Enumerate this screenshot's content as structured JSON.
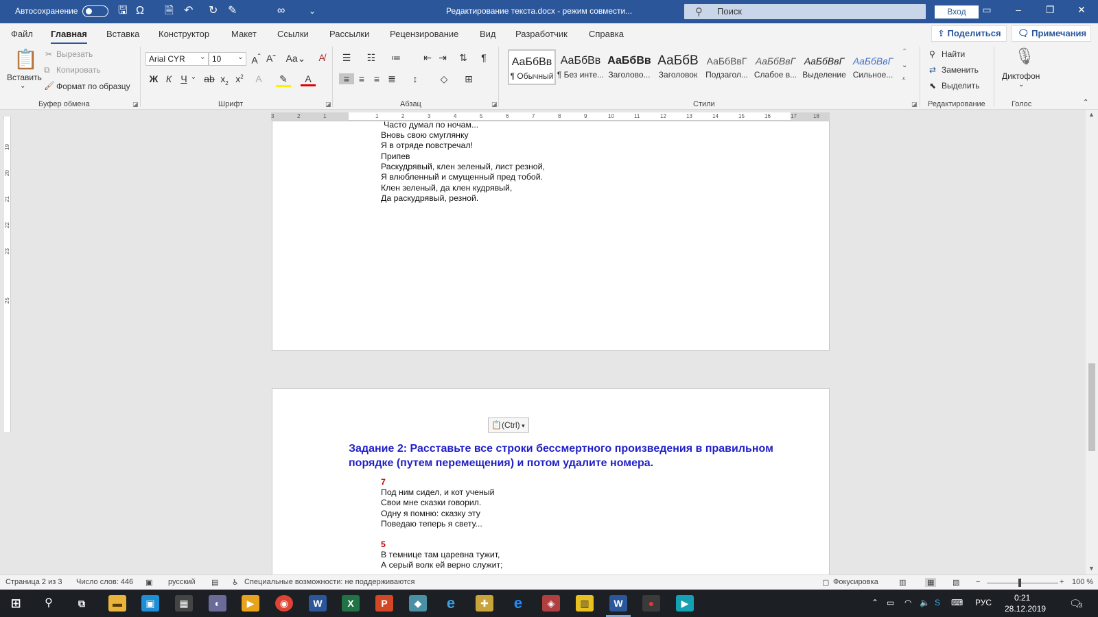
{
  "titlebar": {
    "autosave_label": "Автосохранение",
    "document_title": "Редактирование текста.docx  -  режим совмести...",
    "search_placeholder": "Поиск",
    "signin_label": "Вход"
  },
  "ribbon_tabs": [
    "Файл",
    "Главная",
    "Вставка",
    "Конструктор",
    "Макет",
    "Ссылки",
    "Рассылки",
    "Рецензирование",
    "Вид",
    "Разработчик",
    "Справка"
  ],
  "share_label": "Поделиться",
  "comments_label": "Примечания",
  "clipboard": {
    "paste": "Вставить",
    "cut": "Вырезать",
    "copy": "Копировать",
    "format_painter": "Формат по образцу",
    "group": "Буфер обмена"
  },
  "font": {
    "name": "Arial CYR",
    "size": "10",
    "group": "Шрифт"
  },
  "paragraph": {
    "group": "Абзац"
  },
  "styles": {
    "group": "Стили",
    "items": [
      {
        "sample": "АаБбВв",
        "name": "¶ Обычный"
      },
      {
        "sample": "АаБбВв",
        "name": "¶ Без инте..."
      },
      {
        "sample": "АаБбВв",
        "name": "Заголово..."
      },
      {
        "sample": "АаБбВ",
        "name": "Заголовок"
      },
      {
        "sample": "АаБбВвГ",
        "name": "Подзагол..."
      },
      {
        "sample": "АаБбВвГ",
        "name": "Слабое в..."
      },
      {
        "sample": "АаБбВвГ",
        "name": "Выделение"
      },
      {
        "sample": "АаБбВвГ",
        "name": "Сильное..."
      }
    ]
  },
  "editing": {
    "find": "Найти",
    "replace": "Заменить",
    "select": "Выделить",
    "group": "Редактирование"
  },
  "voice": {
    "dictate": "Диктофон",
    "group": "Голос"
  },
  "ruler_h": [
    "3",
    "2",
    "1",
    "1",
    "2",
    "3",
    "4",
    "5",
    "6",
    "7",
    "8",
    "9",
    "10",
    "11",
    "12",
    "13",
    "14",
    "15",
    "16",
    "17",
    "18"
  ],
  "ruler_v": [
    "19",
    "20",
    "21",
    "22",
    "23",
    "25"
  ],
  "page1_lines": [
    "Часто думал по ночам...",
    " Вновь свою смуглянку",
    " Я в отряде повстречал!",
    "Припев",
    "Раскудрявый, клен зеленый, лист резной,",
    "Я влюбленный и смущенный пред тобой.",
    "Клен зеленый, да клен кудрявый,",
    "Да раскудрявый, резной."
  ],
  "paste_tag": "(Ctrl)",
  "task_heading": "Задание 2: Расставьте все строки бессмертного произведения в правильном порядке (путем перемещения) и потом удалите номера.",
  "page2_blocks": [
    {
      "num": "7",
      "lines": [
        "Под ним сидел, и кот ученый",
        "Свои мне сказки говорил.",
        "Одну я помню: сказку эту",
        "Поведаю теперь я свету..."
      ]
    },
    {
      "num": "5",
      "lines": [
        "В темнице там царевна тужит,",
        "А серый волк ей верно служит;"
      ]
    }
  ],
  "statusbar": {
    "page": "Страница 2 из 3",
    "words": "Число слов: 446",
    "language": "русский",
    "accessibility": "Специальные возможности: не поддерживаются",
    "focus": "Фокусировка",
    "zoom": "100 %"
  },
  "taskbar": {
    "language": "РУС",
    "time": "0:21",
    "date": "28.12.2019",
    "notifications": "3"
  },
  "colors": {
    "titlebar": "#2b579a",
    "heading": "#1f1fc6",
    "number": "#c00000"
  }
}
